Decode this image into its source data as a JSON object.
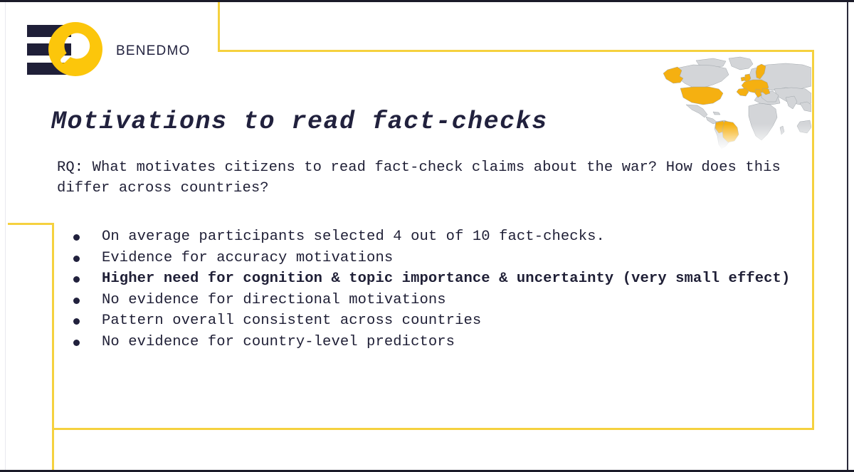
{
  "slide": {
    "brand_name": "BENEDMO",
    "title": "Motivations to read fact-checks",
    "research_question": "RQ: What motivates citizens to read fact-check claims about the war? How does this differ across countries?",
    "bullets": [
      {
        "text": "On average participants selected 4 out of 10 fact-checks.",
        "bold": false
      },
      {
        "text": "Evidence for accuracy motivations",
        "bold": false
      },
      {
        "text": "Higher need for cognition & topic importance & uncertainty (very small effect)",
        "bold": true
      },
      {
        "text": "No evidence for directional motivations",
        "bold": false
      },
      {
        "text": "Pattern overall consistent across countries",
        "bold": false
      },
      {
        "text": "No evidence for country-level predictors",
        "bold": false
      }
    ]
  },
  "map": {
    "caption": "world-map-highlighting-survey-countries",
    "highlight_color": "#f5b011",
    "base_color": "#d3d5d8",
    "border_color": "#9aa0a6",
    "highlighted_regions": [
      "United States",
      "Alaska",
      "Brazil",
      "Peru",
      "Western Europe",
      "Scandinavia"
    ]
  },
  "theme": {
    "accent_yellow": "#f5d13f",
    "logo_yellow": "#fcc60b",
    "navy": "#21213d",
    "background": "#ffffff"
  }
}
